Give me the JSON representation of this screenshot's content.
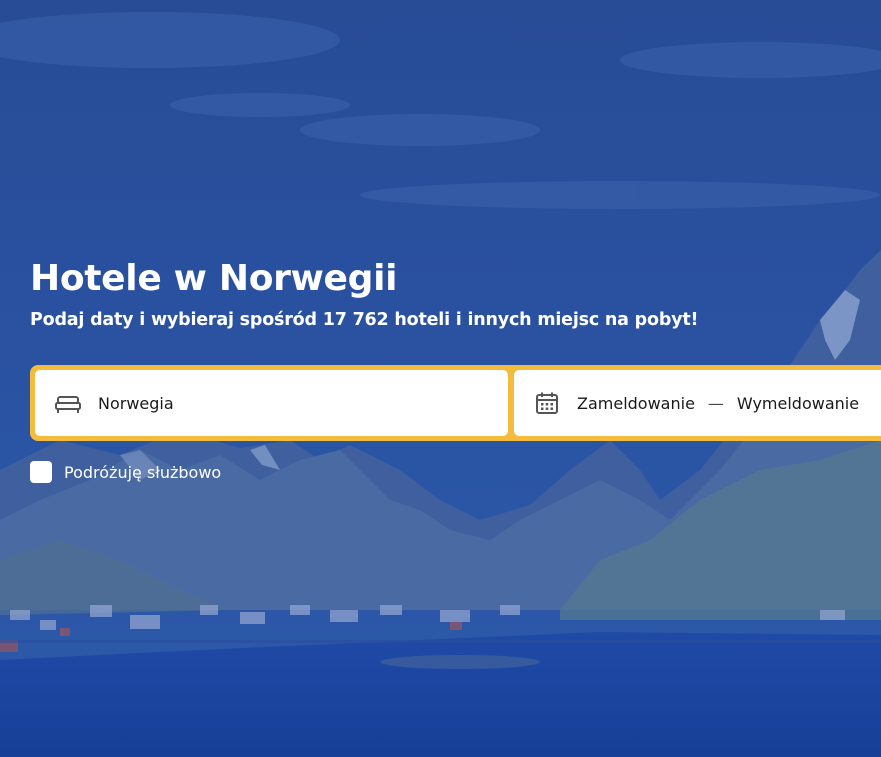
{
  "hero": {
    "title": "Hotele w Norwegii",
    "subtitle": "Podaj daty i wybieraj spośród 17 762 hoteli i innych miejsc na pobyt!",
    "background": "norwegian-fjord-landscape"
  },
  "search": {
    "destination": {
      "value": "Norwegia",
      "icon": "bed-icon"
    },
    "dates": {
      "icon": "calendar-icon",
      "checkin_label": "Zameldowanie",
      "separator": "—",
      "checkout_label": "Wymeldowanie"
    }
  },
  "business_travel": {
    "label": "Podróżuję służbowo",
    "checked": false
  },
  "colors": {
    "searchbar_border": "#f3bc3d",
    "overlay": "#1f4595",
    "text_on_overlay": "#ffffff",
    "field_text": "#1a1a1a"
  }
}
